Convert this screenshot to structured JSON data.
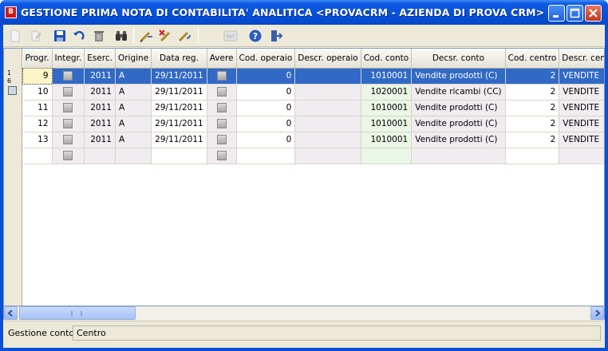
{
  "window": {
    "title": "GESTIONE PRIMA NOTA DI CONTABILITA' ANALITICA <PROVACRM - AZIENDA DI PROVA CRM>",
    "icon": "app-logo-icon",
    "controls": [
      "minimize-icon",
      "maximize-icon",
      "close-icon"
    ]
  },
  "toolbar": {
    "buttons": [
      {
        "icon": "new-document-icon",
        "enabled": false
      },
      {
        "icon": "edit-icon",
        "enabled": false
      },
      {
        "icon": "save-icon",
        "enabled": true
      },
      {
        "icon": "undo-icon",
        "enabled": true
      },
      {
        "icon": "delete-icon",
        "enabled": true
      },
      {
        "icon": "search-binoculars-icon",
        "enabled": true
      },
      {
        "icon": "pencil-add-icon",
        "enabled": true
      },
      {
        "icon": "pencil-delete-icon",
        "enabled": true
      },
      {
        "icon": "pencil-edit-icon",
        "enabled": true
      },
      {
        "icon": "internet-icon",
        "enabled": false
      },
      {
        "icon": "help-icon",
        "enabled": true
      },
      {
        "icon": "exit-icon",
        "enabled": true
      }
    ],
    "int_label": "INT"
  },
  "grid": {
    "row_indicator": {
      "line1": "1",
      "line2": "6"
    },
    "columns": [
      "Progr.",
      "Integr.",
      "Eserc.",
      "Origine",
      "Data reg.",
      "Avere",
      "Cod. operaio",
      "Descr. operaio",
      "Cod. conto",
      "Decsr. conto",
      "Cod. centro",
      "Descr. cen"
    ],
    "rows": [
      {
        "progr": "9",
        "eserc": "2011",
        "origine": "A",
        "data": "29/11/2011",
        "cod_operaio": "0",
        "descr_operaio": "",
        "cod_conto": "1010001",
        "descr_conto": "Vendite prodotti (C)",
        "cod_centro": "2",
        "descr_centro": "VENDITE",
        "selected": true
      },
      {
        "progr": "10",
        "eserc": "2011",
        "origine": "A",
        "data": "29/11/2011",
        "cod_operaio": "0",
        "descr_operaio": "",
        "cod_conto": "1020001",
        "descr_conto": "Vendite ricambi (CC)",
        "cod_centro": "2",
        "descr_centro": "VENDITE",
        "selected": false
      },
      {
        "progr": "11",
        "eserc": "2011",
        "origine": "A",
        "data": "29/11/2011",
        "cod_operaio": "0",
        "descr_operaio": "",
        "cod_conto": "1010001",
        "descr_conto": "Vendite prodotti (C)",
        "cod_centro": "2",
        "descr_centro": "VENDITE",
        "selected": false
      },
      {
        "progr": "12",
        "eserc": "2011",
        "origine": "A",
        "data": "29/11/2011",
        "cod_operaio": "0",
        "descr_operaio": "",
        "cod_conto": "1010001",
        "descr_conto": "Vendite prodotti (C)",
        "cod_centro": "2",
        "descr_centro": "VENDITE",
        "selected": false
      },
      {
        "progr": "13",
        "eserc": "2011",
        "origine": "A",
        "data": "29/11/2011",
        "cod_operaio": "0",
        "descr_operaio": "",
        "cod_conto": "1010001",
        "descr_conto": "Vendite prodotti (C)",
        "cod_centro": "2",
        "descr_centro": "VENDITE",
        "selected": false
      },
      {
        "progr": "",
        "eserc": "",
        "origine": "",
        "data": "",
        "cod_operaio": "",
        "descr_operaio": "",
        "cod_conto": "",
        "descr_conto": "",
        "cod_centro": "",
        "descr_centro": "",
        "selected": false
      }
    ]
  },
  "status": {
    "label": "Gestione conto",
    "value": "Centro"
  },
  "colors": {
    "titlebar": "#0750d9",
    "selection": "#3169c6",
    "current_cell": "#fff4c8",
    "conto_column": "#eaf6e6",
    "shaded_column": "#f0ecf0"
  }
}
